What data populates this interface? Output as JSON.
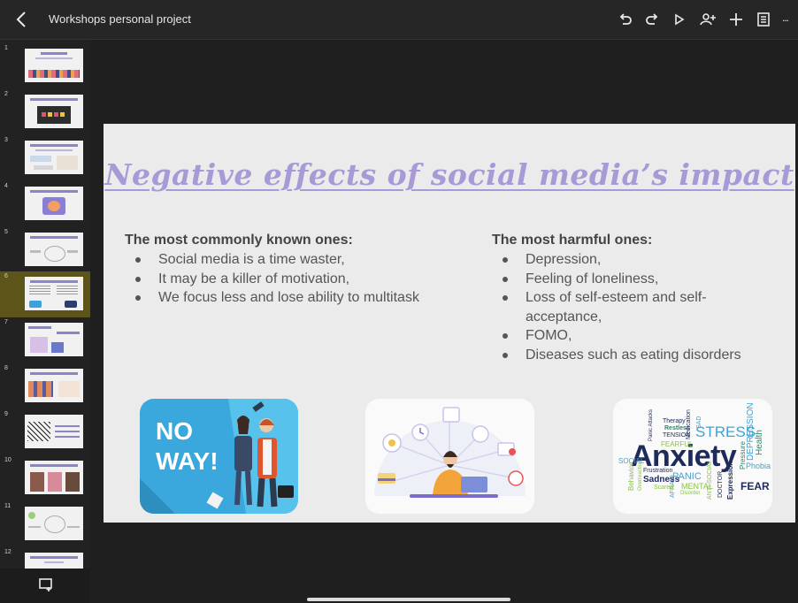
{
  "header": {
    "title": "Workshops personal project",
    "back_icon": "chevron-left-icon",
    "more": "..."
  },
  "toolbar": {
    "icons": [
      "undo-icon",
      "redo-icon",
      "play-icon",
      "add-person-icon",
      "add-icon",
      "comments-icon",
      "more-icon"
    ]
  },
  "sidebar": {
    "slides": [
      {
        "num": "1"
      },
      {
        "num": "2"
      },
      {
        "num": "3"
      },
      {
        "num": "4"
      },
      {
        "num": "5"
      },
      {
        "num": "6",
        "selected": true
      },
      {
        "num": "7"
      },
      {
        "num": "8"
      },
      {
        "num": "9"
      },
      {
        "num": "10"
      },
      {
        "num": "11"
      },
      {
        "num": "12"
      }
    ]
  },
  "slide": {
    "title": "Negative effects of social media’s impact",
    "left": {
      "heading": "The most commonly known ones:",
      "items": [
        "Social media is a time waster,",
        "It may be a killer of motivation,",
        "We focus less and lose ability to multitask"
      ]
    },
    "right": {
      "heading": "The most harmful ones:",
      "items": [
        "Depression,",
        "Feeling of loneliness,",
        "Loss of self-esteem and self-acceptance,",
        "FOMO,",
        "Diseases such as eating disorders"
      ]
    },
    "cards": {
      "noway": {
        "line1": "NO",
        "line2": "WAY!"
      },
      "wordcloud": {
        "big": "Anxiety",
        "words": [
          "STRESS",
          "PANIC",
          "DEPRESSION",
          "Health",
          "Phobia",
          "FEAR",
          "Sadness",
          "MENTAL",
          "Pressure",
          "Therapy",
          "Restless",
          "TENSION",
          "FEARFUL",
          "SOCIAL",
          "Behavior",
          "Frustration",
          "AFRAID",
          "DOCTOR",
          "Expression",
          "ANTI-SOCIAL",
          "SAD",
          "Medication",
          "Panic Attacks",
          "Scared",
          "Disorder",
          "Overreaction"
        ]
      }
    }
  },
  "colors": {
    "title": "#a79ad6",
    "background": "#1f1f1f",
    "selected_thumb": "#5c5418"
  }
}
